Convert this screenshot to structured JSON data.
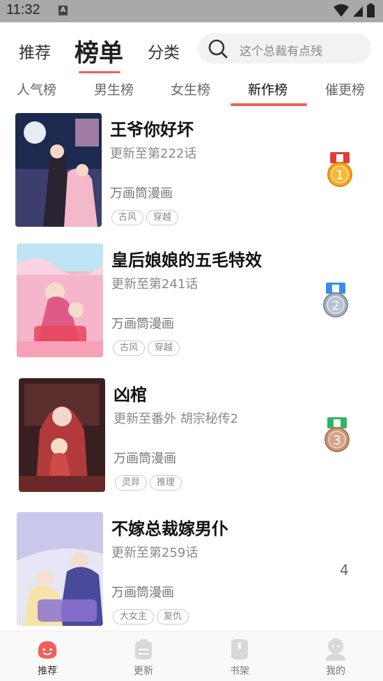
{
  "status_bar": {
    "time": "11:32",
    "notification_letter": "A"
  },
  "top_nav": {
    "tabs": [
      {
        "label": "推荐"
      },
      {
        "label": "榜单"
      },
      {
        "label": "分类"
      }
    ],
    "active_tab": "榜单",
    "search_placeholder": "这个总裁有点残"
  },
  "sub_tabs": {
    "items": [
      {
        "label": "人气榜"
      },
      {
        "label": "男生榜"
      },
      {
        "label": "女生榜"
      },
      {
        "label": "新作榜"
      },
      {
        "label": "催更榜"
      }
    ],
    "active": "新作榜"
  },
  "comics": [
    {
      "rank": "1",
      "title": "王爷你好坏",
      "update": "更新至第222话",
      "publisher": "万画筒漫画",
      "tags": [
        "古风",
        "穿越"
      ],
      "medal": "gold"
    },
    {
      "rank": "2",
      "title": "皇后娘娘的五毛特效",
      "update": "更新至第241话",
      "publisher": "万画筒漫画",
      "tags": [
        "古风",
        "穿越"
      ],
      "medal": "silver"
    },
    {
      "rank": "3",
      "title": "凶棺",
      "update": "更新至番外 胡宗秘传2",
      "publisher": "万画筒漫画",
      "tags": [
        "灵异",
        "推理"
      ],
      "medal": "bronze"
    },
    {
      "rank": "4",
      "title": "不嫁总裁嫁男仆",
      "update": "更新至第259话",
      "publisher": "万画筒漫画",
      "tags": [
        "大女主",
        "复仇"
      ],
      "medal": ""
    }
  ],
  "bottom_nav": {
    "items": [
      {
        "label": "推荐",
        "icon": "smile-blob-icon"
      },
      {
        "label": "更新",
        "icon": "clipboard-icon"
      },
      {
        "label": "书架",
        "icon": "book-icon"
      },
      {
        "label": "我的",
        "icon": "person-icon"
      }
    ],
    "active": "推荐"
  },
  "colors": {
    "accent": "#f0605a",
    "gold": "#f5a623",
    "silver": "#a9b3c2",
    "bronze": "#c99678"
  }
}
